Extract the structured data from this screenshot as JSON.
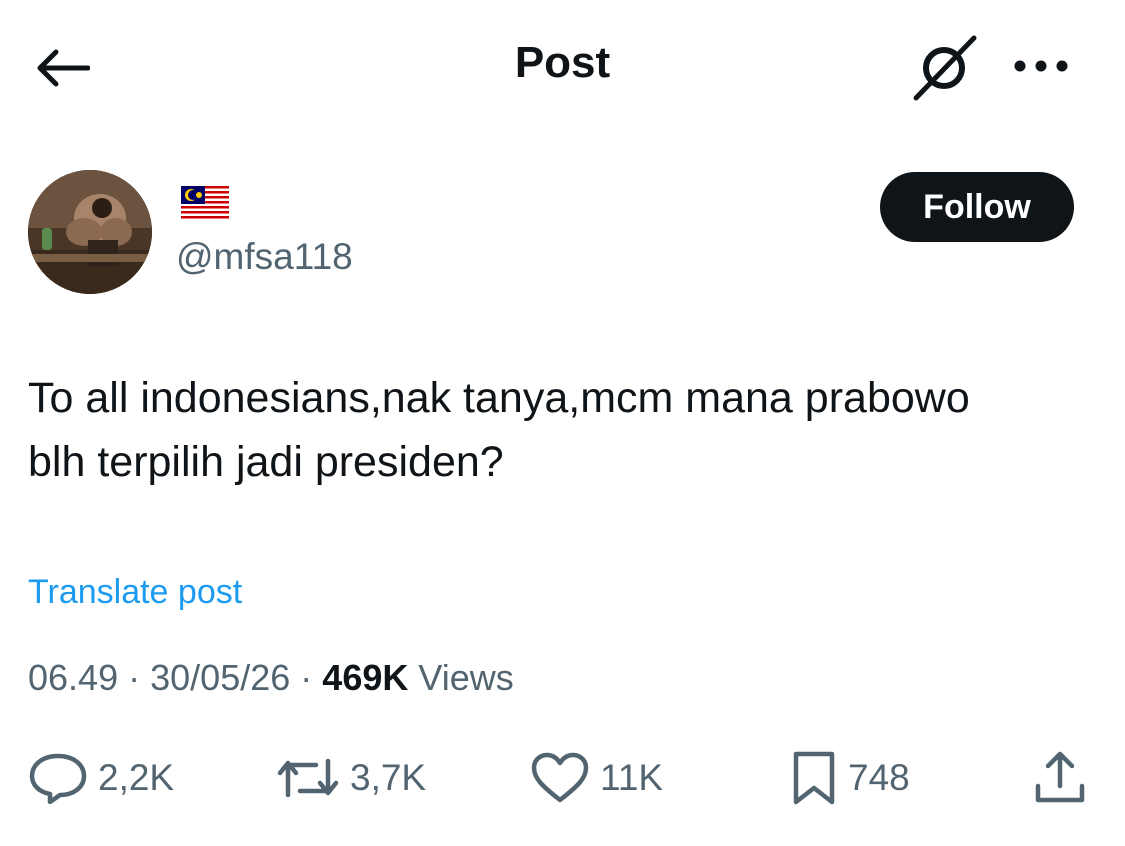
{
  "header": {
    "title": "Post"
  },
  "author": {
    "flag": "🇲🇾",
    "handle": "@mfsa118"
  },
  "follow_label": "Follow",
  "post": {
    "text_line1": "To all indonesians,nak tanya,mcm mana prabowo",
    "text_line2": "blh terpilih jadi presiden?",
    "translate_label": "Translate post",
    "time": "06.49",
    "separator": "·",
    "date": "30/05/26",
    "views_count": "469K",
    "views_label": "Views"
  },
  "actions": {
    "replies": "2,2K",
    "reposts": "3,7K",
    "likes": "11K",
    "bookmarks": "748"
  },
  "colors": {
    "link": "#1d9bf0",
    "secondary": "#536471",
    "primary": "#0f1419"
  },
  "icons": [
    "back-arrow-icon",
    "grok-icon",
    "more-icon",
    "reply-icon",
    "repost-icon",
    "like-icon",
    "bookmark-icon",
    "share-icon"
  ]
}
